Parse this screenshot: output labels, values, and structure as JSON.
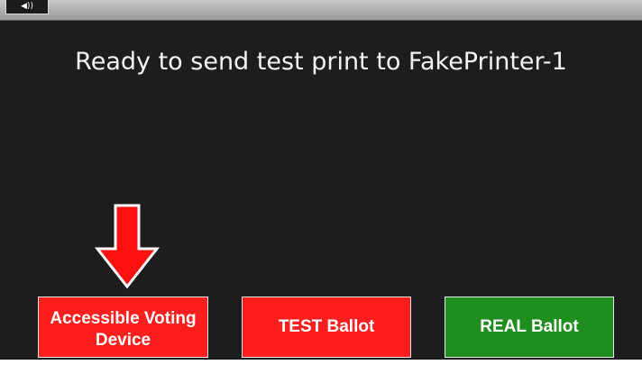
{
  "topbar": {
    "volume_icon_label": "◀))"
  },
  "message": "Ready to send test print to FakePrinter-1",
  "buttons": {
    "accessible_label": "Accessible Voting Device",
    "test_label": "TEST Ballot",
    "real_label": "REAL Ballot"
  },
  "icons": {
    "volume": "speaker-icon",
    "pointer": "down-arrow-icon"
  },
  "colors": {
    "screen_bg": "#1d1d1d",
    "button_red": "#ff1e1e",
    "button_green": "#1e8f1e",
    "arrow_red": "#ff1111"
  }
}
